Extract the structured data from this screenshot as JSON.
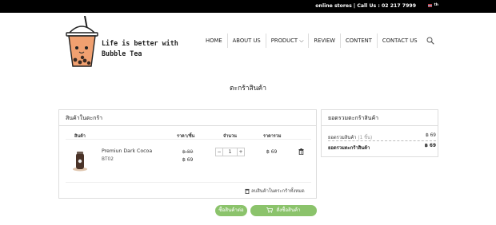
{
  "topbar": {
    "text": "online stores | Call Us : 02 217 7999",
    "lang": "th"
  },
  "logo": {
    "line1": "Life is better with",
    "line2": "Bubble Tea"
  },
  "nav": [
    "HOME",
    "ABOUT US",
    "PRODUCT ⌵",
    "REVIEW",
    "CONTENT",
    "CONTACT US"
  ],
  "page_title": "ตะกร้าสินค้า",
  "cart": {
    "heading": "สินค้าในตะกร้า",
    "columns": {
      "product": "สินค้า",
      "price": "ราคา/ชิ้น",
      "qty": "จำนวน",
      "total": "ราคารวม"
    },
    "item": {
      "name": "Premiun Dark Cocoa",
      "sku": "BT02",
      "old_price": "฿ 89",
      "price": "฿ 69",
      "qty": "1",
      "total": "฿ 69"
    },
    "clear_all": "ลบสินค้าในตระกร้าทั้งหมด"
  },
  "summary": {
    "heading": "ยอดรวมตะกร้าสินค้า",
    "subtotal_label": "ยอดรวมสินค้า",
    "subtotal_count": "(1 ชิ้น)",
    "subtotal_value": "฿ 69",
    "total_label": "ยอดรวมตะกร้าสินค้า",
    "total_value": "฿ 69"
  },
  "buttons": {
    "continue": "ซื้อสินค้าต่อ",
    "checkout": "สั่งซื้อสินค้า"
  },
  "colors": {
    "accent": "#8bc36b",
    "topbar": "#000000",
    "tea": "#f0a070"
  }
}
